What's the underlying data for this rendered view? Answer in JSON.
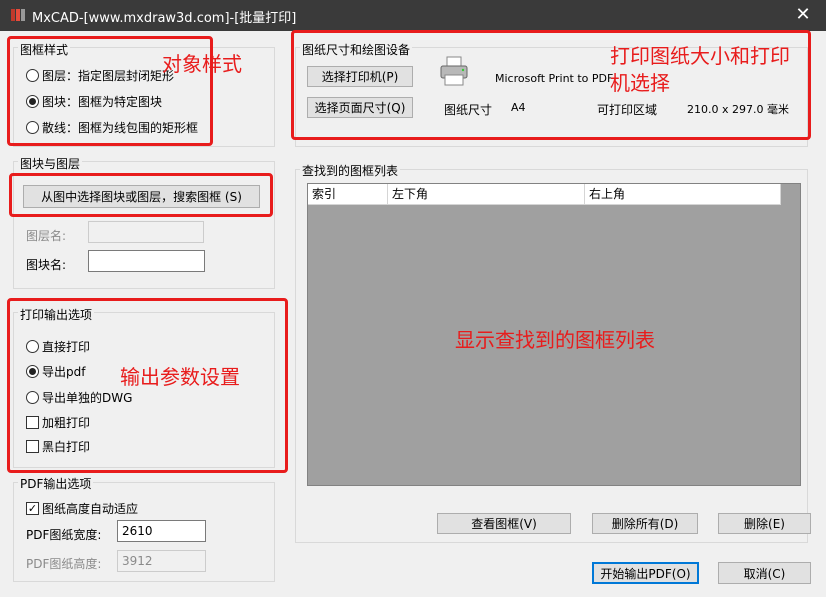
{
  "window": {
    "title": "MxCAD-[www.mxdraw3d.com]-[批量打印]",
    "close": "✕"
  },
  "frame_style": {
    "title": "图框样式",
    "options": [
      {
        "label": "图层：指定图层封闭矩形",
        "selected": false
      },
      {
        "label": "图块：图框为特定图块",
        "selected": true
      },
      {
        "label": "散线：图框为线包围的矩形框",
        "selected": false
      }
    ]
  },
  "block_layer": {
    "title": "图块与图层",
    "select_button": "从图中选择图块或图层，搜索图框 (S)",
    "layer_name_label": "图层名:",
    "layer_name_value": "",
    "block_name_label": "图块名:",
    "block_name_value": ""
  },
  "print_output": {
    "title": "打印输出选项",
    "radios": [
      {
        "label": "直接打印",
        "selected": false
      },
      {
        "label": "导出pdf",
        "selected": true
      },
      {
        "label": "导出单独的DWG",
        "selected": false
      }
    ],
    "checks": [
      {
        "label": "加粗打印",
        "checked": false
      },
      {
        "label": "黑白打印",
        "checked": false
      }
    ]
  },
  "pdf_output": {
    "title": "PDF输出选项",
    "auto_fit_label": "图纸高度自动适应",
    "auto_fit_checked": true,
    "width_label": "PDF图纸宽度:",
    "width_value": "2610",
    "height_label": "PDF图纸高度:",
    "height_value": "3912"
  },
  "paper_device": {
    "title": "图纸尺寸和绘图设备",
    "select_printer_button": "选择打印机(P)",
    "select_page_size_button": "选择页面尺寸(Q)",
    "printer_name": "Microsoft Print to PDF",
    "paper_size_label": "图纸尺寸",
    "paper_size_value": "A4",
    "printable_area_label": "可打印区域",
    "printable_area_value": "210.0 x 297.0 毫米"
  },
  "frame_list": {
    "title": "查找到的图框列表",
    "columns": [
      "索引",
      "左下角",
      "右上角"
    ],
    "rows": []
  },
  "buttons": {
    "view_frame": "查看图框(V)",
    "delete_all": "删除所有(D)",
    "delete": "删除(E)",
    "start_pdf": "开始输出PDF(O)",
    "cancel": "取消(C)"
  },
  "annotations": {
    "object_style": "对象样式",
    "paper_printer": "打印图纸大小和打印",
    "paper_printer_line2": "机选择",
    "output_params": "输出参数设置",
    "list_display": "显示查找到的图框列表"
  },
  "colors": {
    "annotation_red": "#e81c1c",
    "titlebar": "#3a3a3a",
    "listview_bg": "#a0a0a0"
  }
}
